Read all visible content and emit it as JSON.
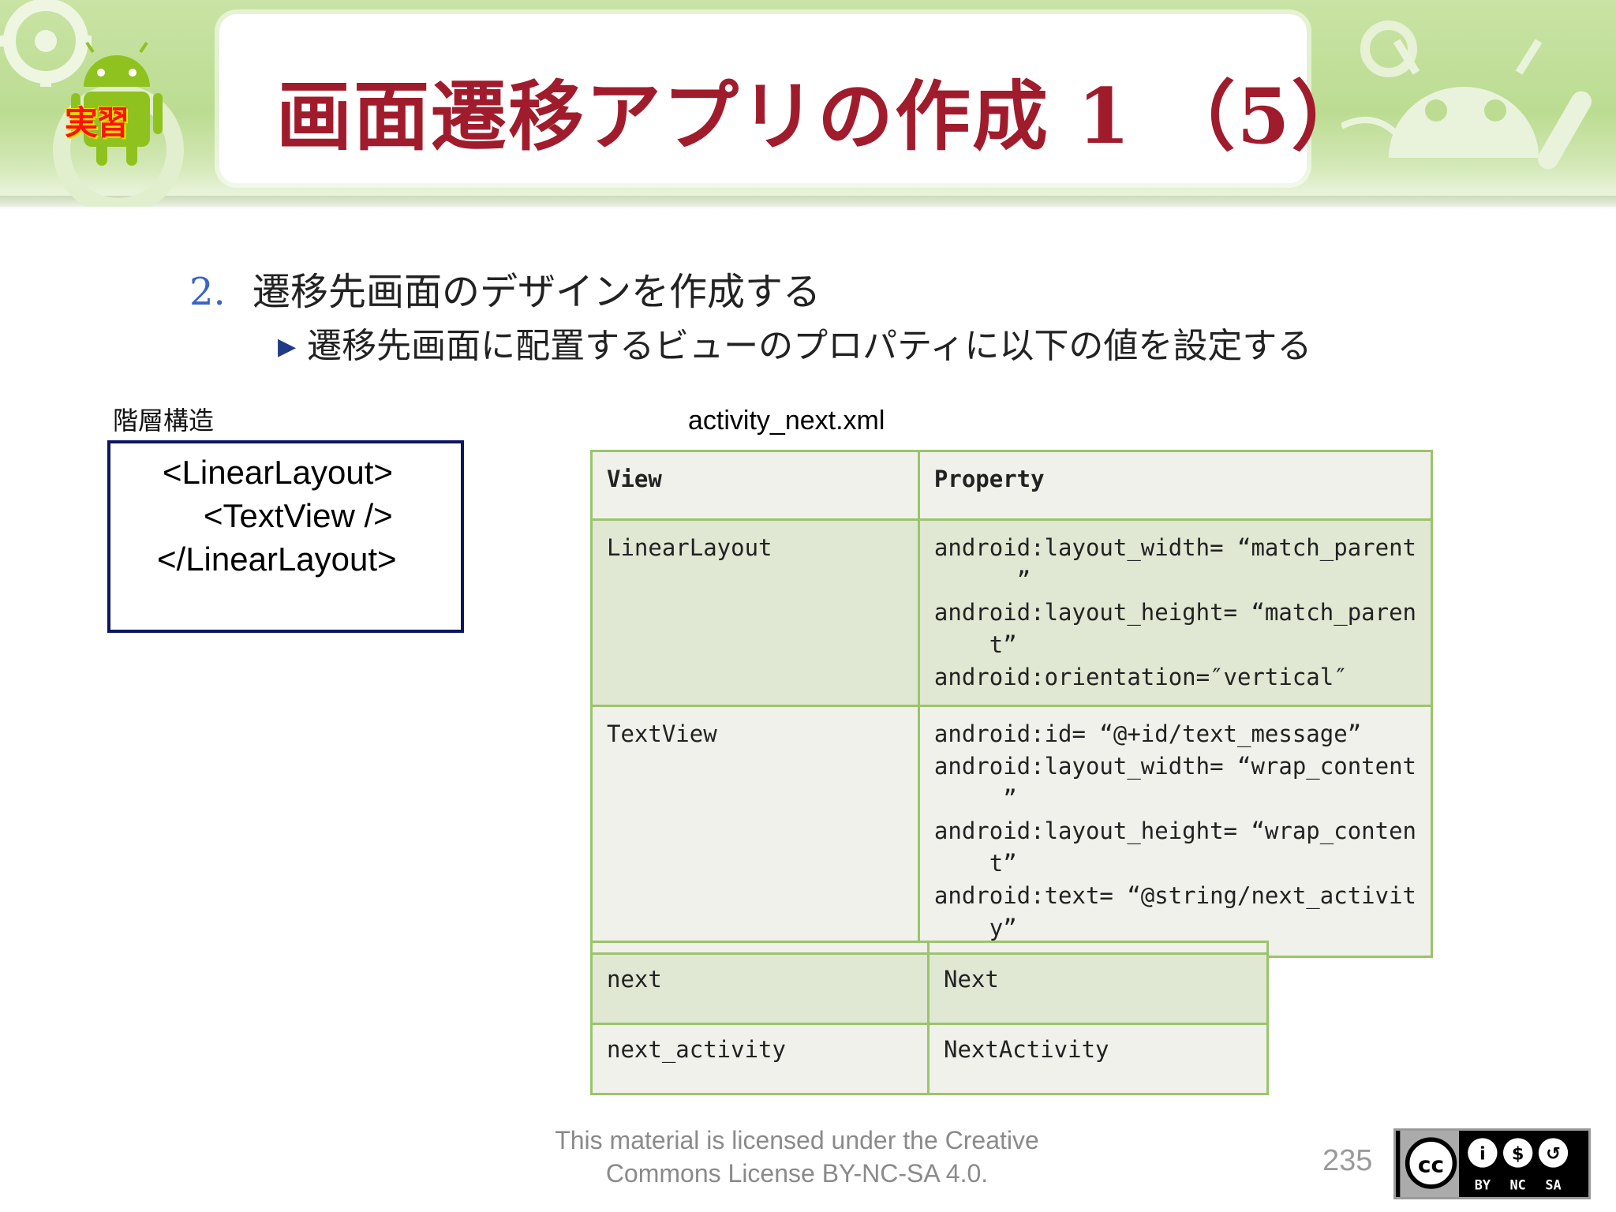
{
  "header": {
    "title": "画面遷移アプリの作成 1 （5）",
    "badge": "実習",
    "banner_color": "#bcdc92",
    "title_color": "#a01c2c"
  },
  "list": {
    "item_number": "2.",
    "item_text": "遷移先画面のデザインを作成する",
    "sub_item_text": "遷移先画面に配置するビューのプロパティに以下の値を設定する"
  },
  "hierarchy": {
    "label": "階層構造",
    "lines": [
      "<LinearLayout>",
      "<TextView />",
      "</LinearLayout>"
    ]
  },
  "table": {
    "file_name": "activity_next.xml",
    "headers": [
      "View",
      "Property"
    ],
    "rows": [
      {
        "view": "LinearLayout",
        "property": "android:layout_width= “match_parent\n      ”\nandroid:layout_height= “match_paren\n    t”\nandroid:orientation=″vertical″"
      },
      {
        "view": "TextView",
        "property": "android:id= “@+id/text_message”\nandroid:layout_width= “wrap_content\n     ”\nandroid:layout_height= “wrap_conten\n    t”\nandroid:text= “@string/next_activit\n    y”"
      }
    ],
    "string_rows": [
      {
        "name": "next",
        "value": "Next"
      },
      {
        "name": "next_activity",
        "value": "NextActivity"
      }
    ]
  },
  "footer": {
    "license_line1": "This material is licensed under the Creative",
    "license_line2": "Commons License BY-NC-SA 4.0.",
    "page_number": "235",
    "cc_labels": [
      "BY",
      "NC",
      "SA"
    ]
  }
}
